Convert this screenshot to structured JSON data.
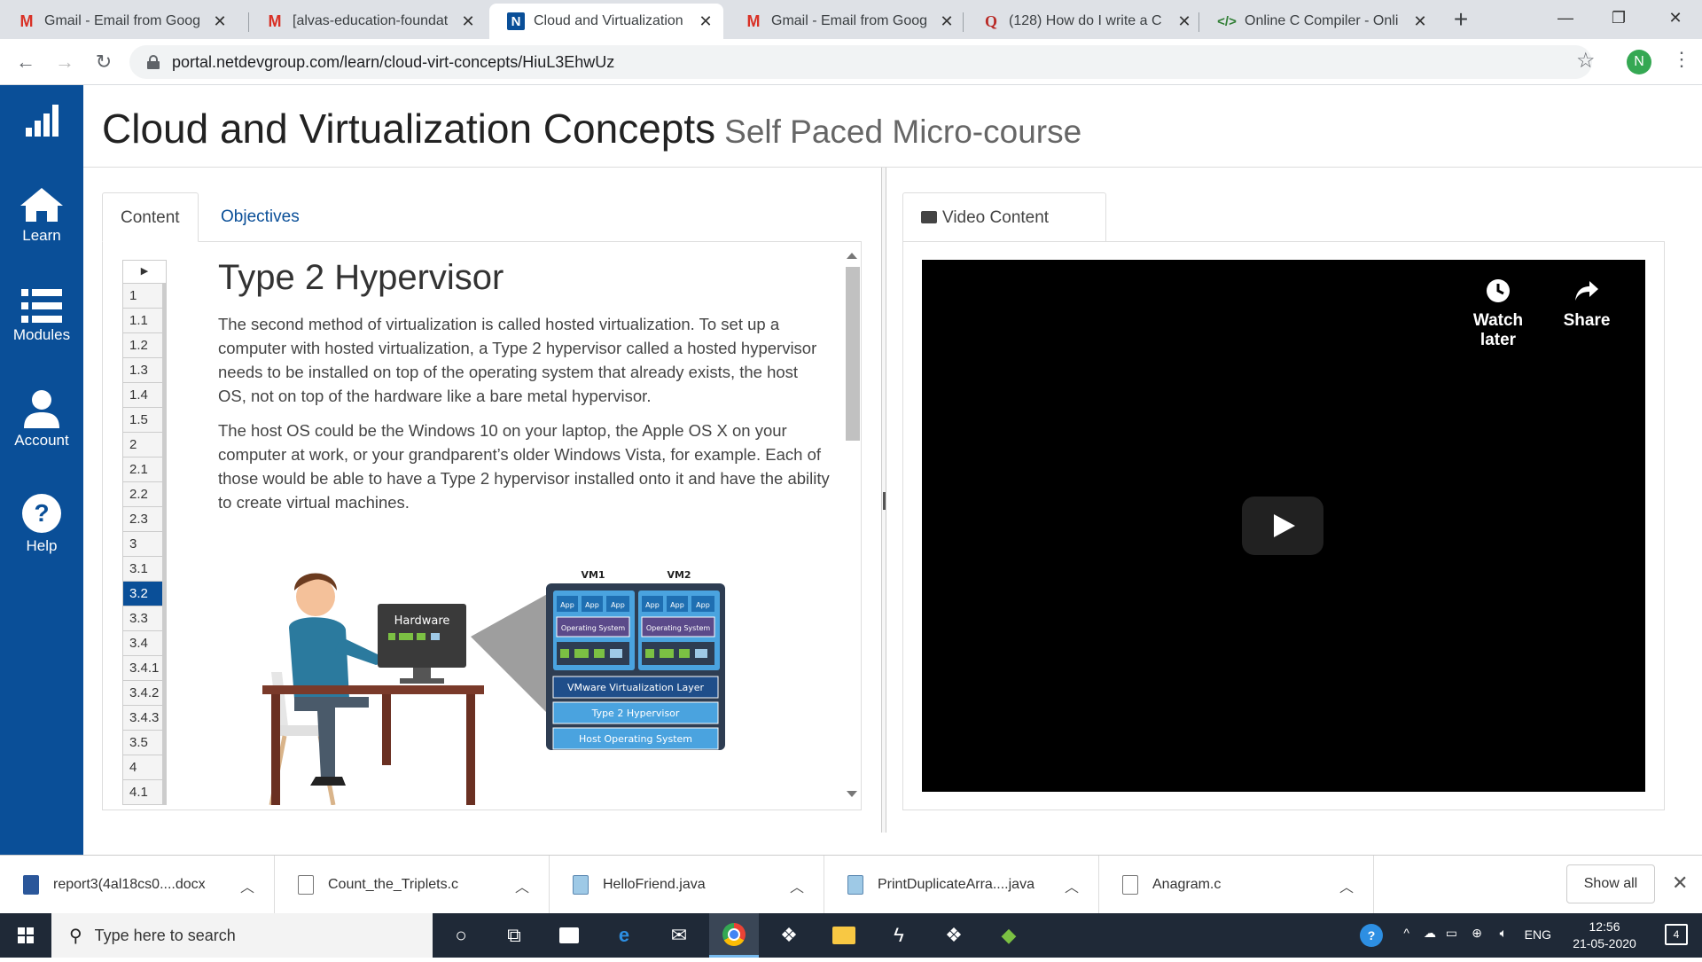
{
  "browser": {
    "tabs": [
      {
        "title": "Gmail - Email from Goog",
        "icon": "gmail-icon"
      },
      {
        "title": "[alvas-education-foundat",
        "icon": "gmail-icon"
      },
      {
        "title": "Cloud and Virtualization",
        "icon": "netdevgroup-icon",
        "active": true
      },
      {
        "title": "Gmail - Email from Goog",
        "icon": "gmail-icon"
      },
      {
        "title": "(128) How do I write a C",
        "icon": "quora-icon"
      },
      {
        "title": "Online C Compiler - Onli",
        "icon": "code-icon"
      }
    ],
    "url": "portal.netdevgroup.com/learn/cloud-virt-concepts/HiuL3EhwUz",
    "profile_initial": "N"
  },
  "sidebar": {
    "items": [
      {
        "label": "",
        "icon": "bar-chart-logo-icon"
      },
      {
        "label": "Learn",
        "icon": "home-icon"
      },
      {
        "label": "Modules",
        "icon": "list-icon"
      },
      {
        "label": "Account",
        "icon": "user-icon"
      },
      {
        "label": "Help",
        "icon": "help-icon"
      }
    ]
  },
  "header": {
    "title": "Cloud and Virtualization Concepts",
    "subtitle": "Self Paced Micro-course"
  },
  "content_panel": {
    "tabs": [
      "Content",
      "Objectives"
    ],
    "toc": [
      "1",
      "1.1",
      "1.2",
      "1.3",
      "1.4",
      "1.5",
      "2",
      "2.1",
      "2.2",
      "2.3",
      "3",
      "3.1",
      "3.2",
      "3.3",
      "3.4",
      "3.4.1",
      "3.4.2",
      "3.4.3",
      "3.5",
      "4",
      "4.1"
    ],
    "toc_selected": "3.2",
    "heading": "Type 2 Hypervisor",
    "paragraphs": [
      "The second method of virtualization is called hosted virtualization. To set up a computer with hosted virtualization, a Type 2 hypervisor called a hosted hypervisor needs to be installed on top of the operating system that already exists, the host OS, not on top of the hardware like a bare metal hypervisor.",
      "The host OS could be the Windows 10 on your laptop, the Apple OS X on your computer at work, or your grandparent’s older Windows Vista, for example. Each of those would be able to have a Type 2 hypervisor installed onto it and have the ability to create virtual machines."
    ],
    "diagram": {
      "monitor_label": "Hardware",
      "vm_labels": [
        "VM1",
        "VM2"
      ],
      "app_label": "App",
      "os_label": "Operating System",
      "layers": [
        "VMware Virtualization Layer",
        "Type 2 Hypervisor",
        "Host Operating System"
      ]
    }
  },
  "video_panel": {
    "tab": "Video Content",
    "watch_later": "Watch later",
    "share": "Share"
  },
  "downloads": {
    "items": [
      {
        "name": "report3(4al18cs0....docx",
        "icon": "word-file-icon"
      },
      {
        "name": "Count_the_Triplets.c",
        "icon": "file-icon"
      },
      {
        "name": "HelloFriend.java",
        "icon": "java-file-icon"
      },
      {
        "name": "PrintDuplicateArra....java",
        "icon": "java-file-icon"
      },
      {
        "name": "Anagram.c",
        "icon": "file-icon"
      }
    ],
    "show_all": "Show all"
  },
  "taskbar": {
    "search_placeholder": "Type here to search",
    "language": "ENG",
    "time": "12:56",
    "date": "21-05-2020",
    "notifications": "4"
  },
  "colors": {
    "brand": "#0a4f98",
    "toc_selected_bg": "#0a4f98"
  }
}
